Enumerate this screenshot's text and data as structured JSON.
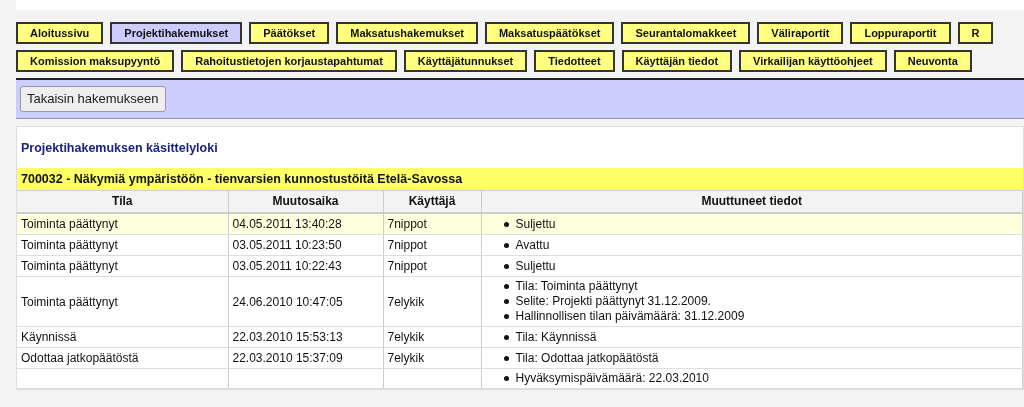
{
  "nav_rows": [
    [
      {
        "label": "Aloitussivu",
        "selected": false
      },
      {
        "label": "Projektihakemukset",
        "selected": true
      },
      {
        "label": "Päätökset",
        "selected": false
      },
      {
        "label": "Maksatushakemukset",
        "selected": false
      },
      {
        "label": "Maksatuspäätökset",
        "selected": false
      },
      {
        "label": "Seurantalomakkeet",
        "selected": false
      },
      {
        "label": "Väliraportit",
        "selected": false
      },
      {
        "label": "Loppuraportit",
        "selected": false
      },
      {
        "label": "R",
        "selected": false
      }
    ],
    [
      {
        "label": "Komission maksupyyntö",
        "selected": false
      },
      {
        "label": "Rahoitustietojen korjaustapahtumat",
        "selected": false
      },
      {
        "label": "Käyttäjätunnukset",
        "selected": false
      },
      {
        "label": "Tiedotteet",
        "selected": false
      },
      {
        "label": "Käyttäjän tiedot",
        "selected": false
      },
      {
        "label": "Virkailijan käyttöohjeet",
        "selected": false
      },
      {
        "label": "Neuvonta",
        "selected": false
      }
    ]
  ],
  "back_button": "Takaisin hakemukseen",
  "log_title": "Projektihakemuksen käsittelyloki",
  "project_heading": "700032 - Näkymiä ympäristöön - tienvarsien kunnostustöitä Etelä-Savossa",
  "table": {
    "columns": [
      "Tila",
      "Muutosaika",
      "Käyttäjä",
      "Muuttuneet tiedot"
    ],
    "rows": [
      {
        "status": "Toiminta päättynyt",
        "time": "04.05.2011 13:40:28",
        "user": "7nippot",
        "changes": [
          "Suljettu"
        ],
        "highlighted": true
      },
      {
        "status": "Toiminta päättynyt",
        "time": "03.05.2011 10:23:50",
        "user": "7nippot",
        "changes": [
          "Avattu"
        ],
        "highlighted": false
      },
      {
        "status": "Toiminta päättynyt",
        "time": "03.05.2011 10:22:43",
        "user": "7nippot",
        "changes": [
          "Suljettu"
        ],
        "highlighted": false
      },
      {
        "status": "Toiminta päättynyt",
        "time": "24.06.2010 10:47:05",
        "user": "7elykik",
        "changes": [
          "Tila: Toiminta päättynyt",
          "Selite: Projekti päättynyt 31.12.2009.",
          "Hallinnollisen tilan päivämäärä: 31.12.2009"
        ],
        "highlighted": false
      },
      {
        "status": "Käynnissä",
        "time": "22.03.2010 15:53:13",
        "user": "7elykik",
        "changes": [
          "Tila: Käynnissä"
        ],
        "highlighted": false
      },
      {
        "status": "Odottaa jatkopäätöstä",
        "time": "22.03.2010 15:37:09",
        "user": "7elykik",
        "changes": [
          "Tila: Odottaa jatkopäätöstä"
        ],
        "highlighted": false
      },
      {
        "changes": [
          "Hyväksymispäivämäärä: 22.03.2010"
        ],
        "highlighted": false
      }
    ]
  }
}
